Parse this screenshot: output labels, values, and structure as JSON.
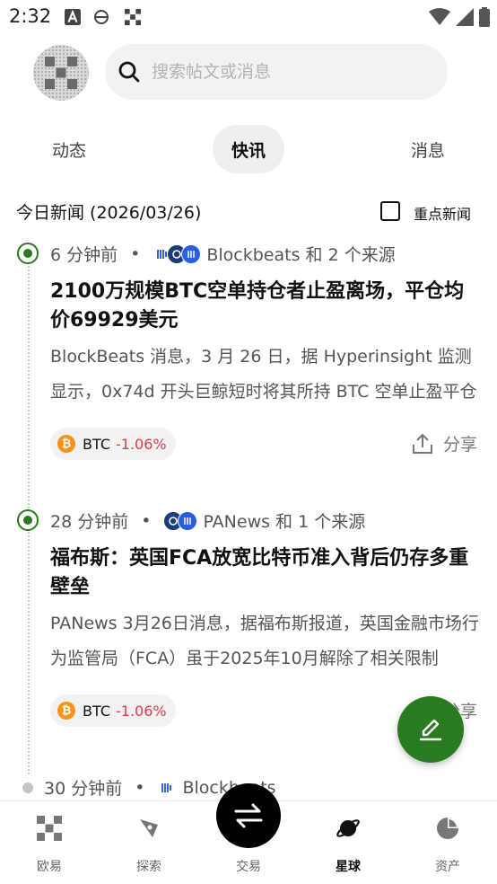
{
  "status_bar": {
    "time": "2:32"
  },
  "search": {
    "placeholder": "搜索帖文或消息"
  },
  "tabs": [
    {
      "label": "动态",
      "active": false
    },
    {
      "label": "快讯",
      "active": true
    },
    {
      "label": "消息",
      "active": false
    }
  ],
  "section": {
    "title": "今日新闻 (2026/03/26)",
    "filter_label": "重点新闻",
    "filter_checked": false
  },
  "news": [
    {
      "time": "6 分钟前",
      "source": "Blockbeats 和 2 个来源",
      "headline": "2100万规模BTC空单持仓者止盈离场，平仓均价69929美元",
      "summary": "BlockBeats 消息，3 月 26 日，据 Hyperinsight 监测显示，0x74d 开头巨鲸短时将其所持 BTC 空单止盈平仓",
      "coin": {
        "symbol": "BTC",
        "change": "-1.06%"
      },
      "share_label": "分享"
    },
    {
      "time": "28 分钟前",
      "source": "PANews 和 1 个来源",
      "headline": "福布斯：英国FCA放宽比特币准入背后仍存多重壁垒",
      "summary": "PANews 3月26日消息，据福布斯报道，英国金融市场行为监管局（FCA）虽于2025年10月解除了相关限制",
      "coin": {
        "symbol": "BTC",
        "change": "-1.06%"
      },
      "share_label": "分享"
    },
    {
      "time": "30 分钟前",
      "source": "Blockbeats"
    }
  ],
  "bottom_nav": [
    {
      "label": "欧易",
      "icon": "okx-logo-icon",
      "active": false
    },
    {
      "label": "探索",
      "icon": "compass-icon",
      "active": false
    },
    {
      "label": "交易",
      "icon": "swap-arrows-icon",
      "active": false
    },
    {
      "label": "星球",
      "icon": "planet-icon",
      "active": true
    },
    {
      "label": "资产",
      "icon": "pie-chart-icon",
      "active": false
    }
  ],
  "colors": {
    "accent_green": "#2a7a1f",
    "negative_red": "#e0394f",
    "btc_orange": "#f7931a"
  }
}
